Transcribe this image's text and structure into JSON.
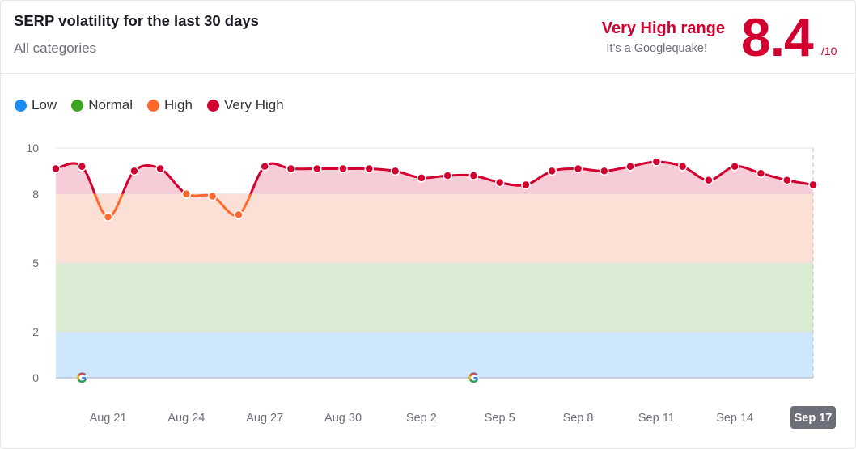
{
  "header": {
    "title": "SERP volatility for the last 30 days",
    "subtitle": "All categories",
    "range_label": "Very High range",
    "range_note": "It’s a Googlequake!",
    "score": "8.4",
    "score_max": "/10"
  },
  "legend": [
    {
      "label": "Low",
      "color": "#1a8cf0"
    },
    {
      "label": "Normal",
      "color": "#3ba51f"
    },
    {
      "label": "High",
      "color": "#ff6a2c"
    },
    {
      "label": "Very High",
      "color": "#d1002f"
    }
  ],
  "chart_data": {
    "type": "line",
    "ylim": [
      0,
      10
    ],
    "yticks": [
      0,
      2,
      5,
      8,
      10
    ],
    "bands": [
      {
        "name": "Low",
        "from": 0,
        "to": 2,
        "color": "#cfe7fd"
      },
      {
        "name": "Normal",
        "from": 2,
        "to": 5,
        "color": "#d9ecd3"
      },
      {
        "name": "High",
        "from": 5,
        "to": 8,
        "color": "#fde0d5"
      },
      {
        "name": "Very High",
        "from": 8,
        "to": 10,
        "color": "#f6ccd7"
      }
    ],
    "x": [
      "Aug 19",
      "Aug 20",
      "Aug 21",
      "Aug 22",
      "Aug 23",
      "Aug 24",
      "Aug 25",
      "Aug 26",
      "Aug 27",
      "Aug 28",
      "Aug 29",
      "Aug 30",
      "Aug 31",
      "Sep 1",
      "Sep 2",
      "Sep 3",
      "Sep 4",
      "Sep 5",
      "Sep 6",
      "Sep 7",
      "Sep 8",
      "Sep 9",
      "Sep 10",
      "Sep 11",
      "Sep 12",
      "Sep 13",
      "Sep 14",
      "Sep 15",
      "Sep 16",
      "Sep 17"
    ],
    "values": [
      9.1,
      9.2,
      7.0,
      9.0,
      9.1,
      8.0,
      7.9,
      7.1,
      9.2,
      9.1,
      9.1,
      9.1,
      9.1,
      9.0,
      8.7,
      8.8,
      8.8,
      8.5,
      8.4,
      9.0,
      9.1,
      9.0,
      9.2,
      9.4,
      9.2,
      8.6,
      9.2,
      8.9,
      8.6,
      8.4
    ],
    "xtick_labels": [
      "Aug 21",
      "Aug 24",
      "Aug 27",
      "Aug 30",
      "Sep 2",
      "Sep 5",
      "Sep 8",
      "Sep 11",
      "Sep 14",
      "Sep 17"
    ],
    "selected_label": "Sep 17",
    "google_update_markers": [
      "Aug 20",
      "Sep 4"
    ],
    "colors": {
      "very_high": "#d1002f",
      "high": "#ff6a2c"
    }
  }
}
